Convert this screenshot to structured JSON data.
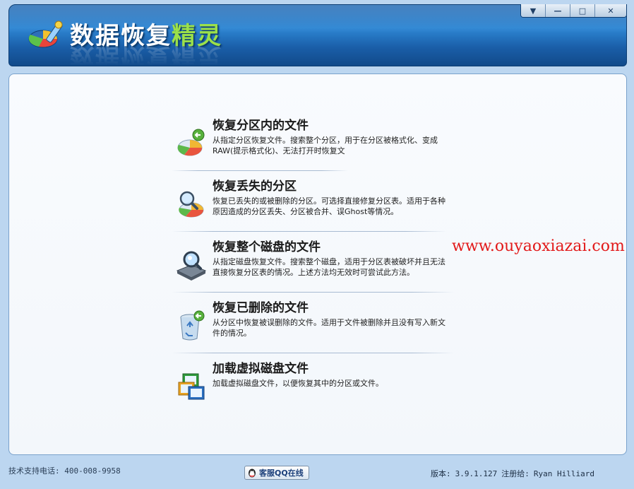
{
  "header": {
    "title_main": "数据恢复",
    "title_accent": "精灵",
    "window_buttons": [
      "▼",
      "—",
      "□",
      "✕"
    ]
  },
  "options": [
    {
      "title": "恢复分区内的文件",
      "desc": "从指定分区恢复文件。搜索整个分区，用于在分区被格式化、变成\nRAW(提示格式化)、无法打开时恢复文",
      "icon": "pie-chart-restore-icon"
    },
    {
      "title": "恢复丢失的分区",
      "desc": "恢复已丢失的或被删除的分区。可选择直接修复分区表。适用于各种\n原因造成的分区丢失、分区被合并、误Ghost等情况。",
      "icon": "magnifier-pie-icon"
    },
    {
      "title": "恢复整个磁盘的文件",
      "desc": "从指定磁盘恢复文件。搜索整个磁盘，适用于分区表被破坏并且无法\n直接恢复分区表的情况。上述方法均无效时可尝试此方法。",
      "icon": "disk-search-icon"
    },
    {
      "title": "恢复已删除的文件",
      "desc": "从分区中恢复被误删除的文件。适用于文件被删除并且没有写入新文\n件的情况。",
      "icon": "recycle-bin-icon"
    },
    {
      "title": "加载虚拟磁盘文件",
      "desc": "加载虚拟磁盘文件，以便恢复其中的分区或文件。",
      "icon": "virtual-disk-icon"
    }
  ],
  "watermark": "www.ouyaoxiazai.com",
  "footer": {
    "support": "技术支持电话: 400-008-9958",
    "qq_button": "客服QQ在线",
    "version_label": "版本:",
    "version_value": "3.9.1.127",
    "registered_label": "注册给:",
    "registered_value": "Ryan Hilliard"
  },
  "colors": {
    "header_blue": "#1f67b2",
    "watermark_red": "#e21a1a",
    "accent_green": "#9be04a"
  }
}
